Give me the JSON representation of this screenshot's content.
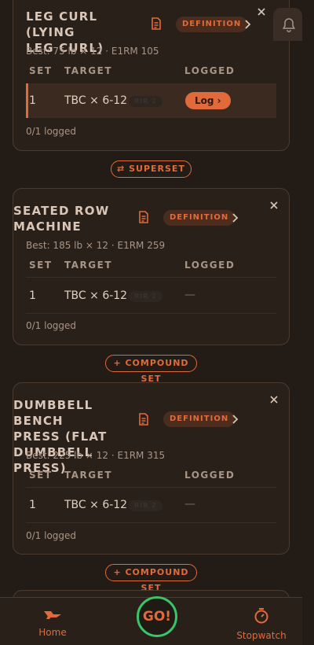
{
  "exercises": [
    {
      "title_line1": "LEG CURL (LYING",
      "title_line2": "LEG CURL)",
      "title_line3": "",
      "definition_label": "DEFINITION",
      "best": "Best: 75 lb × 12 · E1RM 105",
      "headers": {
        "set": "SET",
        "target": "TARGET",
        "logged": "LOGGED"
      },
      "sets": [
        {
          "set": "1",
          "target": "TBC × 6-12",
          "rir": "RIR 2",
          "action": "Log ›",
          "logged": ""
        }
      ],
      "logged_count": "0/1 logged"
    },
    {
      "title_line1": "SEATED ROW",
      "title_line2": "MACHINE",
      "title_line3": "",
      "definition_label": "DEFINITION",
      "best": "Best: 185 lb × 12 · E1RM 259",
      "headers": {
        "set": "SET",
        "target": "TARGET",
        "logged": "LOGGED"
      },
      "sets": [
        {
          "set": "1",
          "target": "TBC × 6-12",
          "rir": "RIR 2",
          "logged": "—"
        }
      ],
      "logged_count": "0/1 logged"
    },
    {
      "title_line1": "DUMBBELL BENCH",
      "title_line2": "PRESS (FLAT",
      "title_line3": "DUMBBELL PRESS)",
      "definition_label": "DEFINITION",
      "best": "Best: 225 lb × 12 · E1RM 315",
      "headers": {
        "set": "SET",
        "target": "TARGET",
        "logged": "LOGGED"
      },
      "sets": [
        {
          "set": "1",
          "target": "TBC × 6-12",
          "rir": "RIR 2",
          "logged": "—"
        }
      ],
      "logged_count": "0/1 logged"
    }
  ],
  "connectors": {
    "superset": "⇄ SUPERSET",
    "compound_1": "+ COMPOUND SET",
    "compound_2": "+ COMPOUND SET"
  },
  "nav": {
    "home": "Home",
    "go": "GO!",
    "stopwatch": "Stopwatch"
  },
  "colors": {
    "accent": "#e06a3a",
    "go_ring": "#3ac46a",
    "background": "#231b16"
  }
}
